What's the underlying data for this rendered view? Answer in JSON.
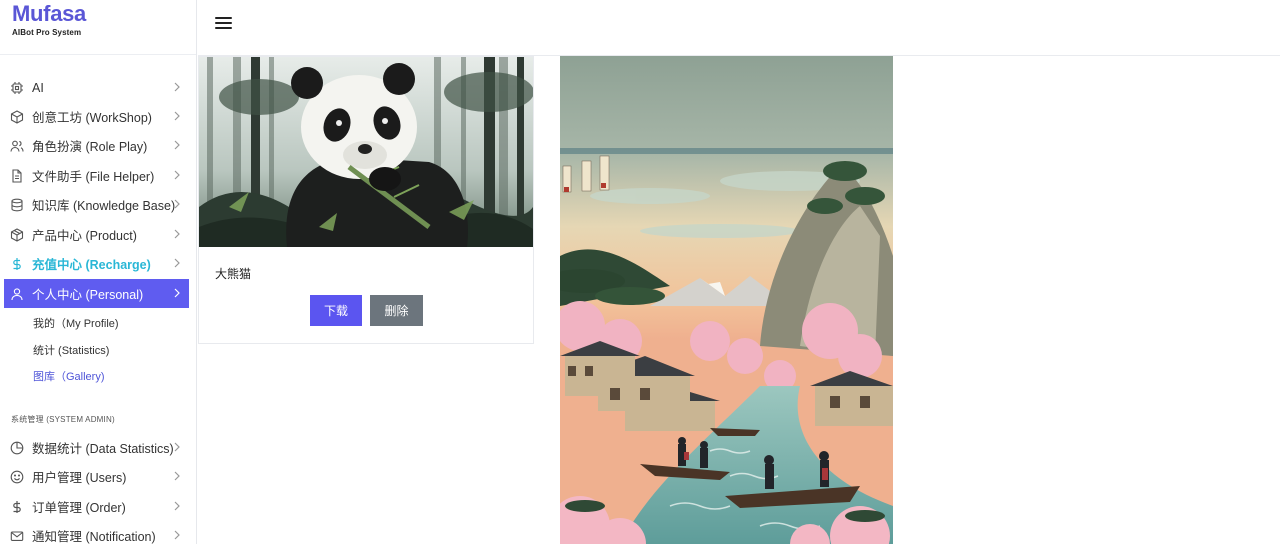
{
  "brand": {
    "title": "Mufasa",
    "subtitle": "AIBot Pro System"
  },
  "nav": [
    {
      "label": "AI",
      "icon": "chip-icon"
    },
    {
      "label": "创意工坊 (WorkShop)",
      "icon": "cube-icon"
    },
    {
      "label": "角色扮演 (Role Play)",
      "icon": "users-icon"
    },
    {
      "label": "文件助手 (File Helper)",
      "icon": "file-icon"
    },
    {
      "label": "知识库 (Knowledge Base)",
      "icon": "database-icon"
    },
    {
      "label": "产品中心 (Product)",
      "icon": "box-icon"
    },
    {
      "label": "充值中心 (Recharge)",
      "icon": "dollar-icon"
    },
    {
      "label": "个人中心 (Personal)",
      "icon": "user-icon"
    }
  ],
  "personal_sub": [
    {
      "label": "我的（My Profile)"
    },
    {
      "label": "统计 (Statistics)"
    },
    {
      "label": "图库（Gallery)"
    }
  ],
  "admin_section_label": "系统管理 (SYSTEM ADMIN)",
  "admin_nav": [
    {
      "label": "数据统计 (Data Statistics)",
      "icon": "pie-chart-icon"
    },
    {
      "label": "用户管理 (Users)",
      "icon": "smile-icon"
    },
    {
      "label": "订单管理 (Order)",
      "icon": "dollar-icon"
    },
    {
      "label": "通知管理 (Notification)",
      "icon": "mail-icon"
    }
  ],
  "gallery": [
    {
      "caption": "大熊猫",
      "download_label": "下载",
      "delete_label": "删除",
      "image": "panda-in-bamboo-forest"
    },
    {
      "image": "ukiyo-e-river-village-with-cherry-blossoms"
    }
  ],
  "colors": {
    "brand": "#5a56d6",
    "active_nav": "#5f5cf0",
    "recharge": "#2ab7d6",
    "delete": "#6c757d"
  }
}
